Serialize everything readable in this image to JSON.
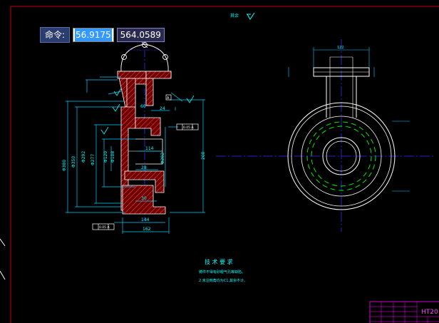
{
  "command": {
    "label": "命令:",
    "x_value": "56.9175",
    "y_value": "564.0589"
  },
  "drawing": {
    "roughness_note": "其余",
    "tech_req_title": "技 术 要 求",
    "tech_req_line1": "铸件不得有砂眼气孔等缺陷。",
    "tech_req_line2": "2.未注倒角均为C1,其余不计。",
    "material": "HT20",
    "dims": {
      "d380": "Φ380",
      "d350": "Φ350",
      "d292": "Φ292",
      "d277": "Φ277",
      "d120": "Φ120",
      "d108": "Φ108",
      "d282": "Φ282",
      "d114": "114",
      "d200": "200",
      "d144": "144",
      "d162": "162",
      "d28": "28",
      "d24": "24",
      "d60": "60",
      "d30": "30",
      "dim_top": "122"
    },
    "tolerance_a": "0.05 A",
    "datum_a": "A"
  },
  "colors": {
    "frame": "#cc0000",
    "outline": "#ffffff",
    "dimension": "#00d0ff",
    "center": "#3030ff",
    "hatch": "#ff3030",
    "section_fill": "#700000",
    "hidden": "#00ff00",
    "text_cyan": "#00ffff",
    "titleblock": "#ff00ff"
  }
}
